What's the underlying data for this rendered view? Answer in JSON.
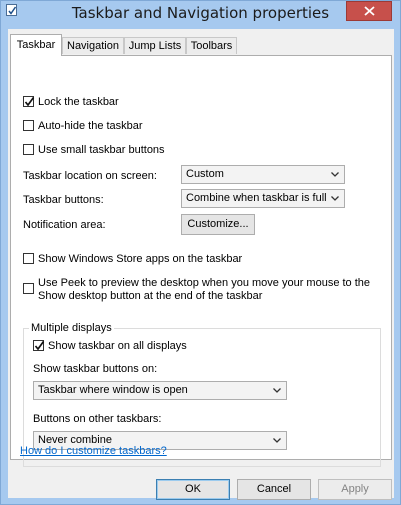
{
  "window": {
    "title": "Taskbar and Navigation properties"
  },
  "tabs": [
    {
      "label": "Taskbar",
      "active": true
    },
    {
      "label": "Navigation",
      "active": false
    },
    {
      "label": "Jump Lists",
      "active": false
    },
    {
      "label": "Toolbars",
      "active": false
    }
  ],
  "taskbar": {
    "lock_taskbar": {
      "label": "Lock the taskbar",
      "checked": true
    },
    "auto_hide": {
      "label": "Auto-hide the taskbar",
      "checked": false
    },
    "small_buttons": {
      "label": "Use small taskbar buttons",
      "checked": false
    },
    "location": {
      "label": "Taskbar location on screen:",
      "value": "Custom"
    },
    "buttons": {
      "label": "Taskbar buttons:",
      "value": "Combine when taskbar is full"
    },
    "notification": {
      "label": "Notification area:",
      "button": "Customize..."
    },
    "store_apps": {
      "label": "Show Windows Store apps on the taskbar",
      "checked": false
    },
    "peek": {
      "line1": "Use Peek to preview the desktop when you move your mouse to the",
      "line2": "Show desktop button at the end of the taskbar",
      "checked": false
    }
  },
  "multiple_displays": {
    "title": "Multiple displays",
    "show_all": {
      "label": "Show taskbar on all displays",
      "checked": true
    },
    "show_buttons_on": {
      "label": "Show taskbar buttons on:",
      "value": "Taskbar where window is open"
    },
    "other_buttons": {
      "label": "Buttons on other taskbars:",
      "value": "Never combine"
    }
  },
  "help_link": "How do I customize taskbars?",
  "footer": {
    "ok": "OK",
    "cancel": "Cancel",
    "apply": "Apply"
  },
  "colors": {
    "frame": "#a6c9ef",
    "close": "#c7504b",
    "link": "#0066cc"
  }
}
